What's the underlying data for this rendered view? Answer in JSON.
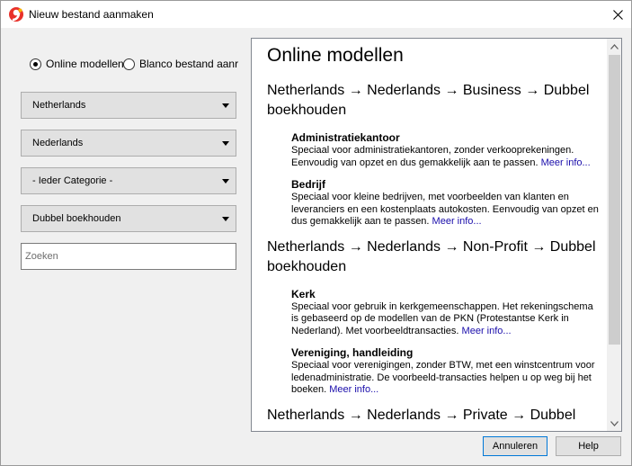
{
  "window": {
    "title": "Nieuw bestand aanmaken"
  },
  "left": {
    "radio_online": "Online modellen",
    "radio_blank": "Blanco bestand aanr",
    "selects": [
      "Netherlands",
      "Nederlands",
      "- Ieder Categorie -",
      "Dubbel boekhouden"
    ],
    "search_placeholder": "Zoeken"
  },
  "content": {
    "heading": "Online modellen",
    "groups": [
      {
        "title": "Netherlands → Nederlands → Business → Dubbel boekhouden",
        "items": [
          {
            "title": "Administratiekantoor",
            "desc": "Speciaal voor administratiekantoren, zonder verkooprekeningen. Eenvoudig van opzet en dus gemakkelijk aan te passen.",
            "link": "Meer info..."
          },
          {
            "title": "Bedrijf",
            "desc": "Speciaal voor kleine bedrijven, met voorbeelden van klanten en leveranciers en een kostenplaats autokosten. Eenvoudig van opzet en dus gemakkelijk aan te passen.",
            "link": "Meer info..."
          }
        ]
      },
      {
        "title": "Netherlands → Nederlands → Non-Profit → Dubbel boekhouden",
        "items": [
          {
            "title": "Kerk",
            "desc": "Speciaal voor gebruik in kerkgemeenschappen. Het rekeningschema is gebaseerd op de modellen van de PKN (Protestantse Kerk in Nederland). Met voorbeeldtransacties.",
            "link": "Meer info..."
          },
          {
            "title": "Vereniging, handleiding",
            "desc": "Speciaal voor verenigingen, zonder BTW, met een winstcentrum voor ledenadministratie. De voorbeeld-transacties helpen u op weg bij het boeken.",
            "link": "Meer info..."
          }
        ]
      },
      {
        "title": "Netherlands → Nederlands → Private → Dubbel",
        "items": []
      }
    ]
  },
  "buttons": {
    "cancel": "Annuleren",
    "help": "Help"
  },
  "colors": {
    "link": "#1a0dab",
    "primary_border": "#0078d7",
    "app_icon": "#e8312a"
  }
}
